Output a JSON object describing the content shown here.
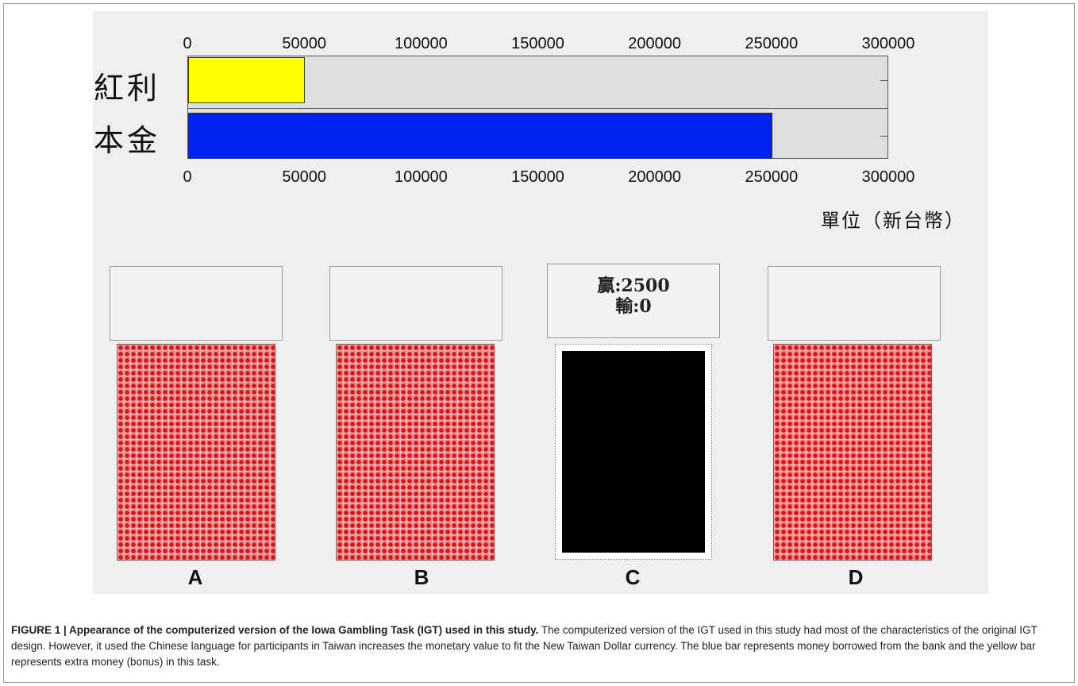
{
  "app": {
    "bar_labels": {
      "bonus": "紅利",
      "principal": "本金"
    },
    "axis": {
      "min": 0,
      "max": 300000,
      "ticks": [
        "0",
        "50000",
        "100000",
        "150000",
        "200000",
        "250000",
        "300000"
      ],
      "unit_label": "單位（新台幣）"
    },
    "bars": {
      "bonus": {
        "value": 50000,
        "color": "#ffff00"
      },
      "principal": {
        "value": 250000,
        "color": "#0022ee"
      }
    },
    "decks": [
      {
        "label": "A",
        "feedback_win": "",
        "feedback_loss": "",
        "selected": false
      },
      {
        "label": "B",
        "feedback_win": "",
        "feedback_loss": "",
        "selected": false
      },
      {
        "label": "C",
        "feedback_win": "贏:2500",
        "feedback_loss": "輸:0",
        "selected": true
      },
      {
        "label": "D",
        "feedback_win": "",
        "feedback_loss": "",
        "selected": false
      }
    ],
    "colors": {
      "background": "#efefef",
      "deck_pattern": "#e02020",
      "selected_card": "#000000"
    }
  },
  "caption": {
    "title": "FIGURE 1 | Appearance of the computerized version of the Iowa Gambling Task (IGT) used in this study.",
    "body": "The computerized version of the IGT used in this study had most of the characteristics of the original IGT design. However, it used the Chinese language for participants in Taiwan increases the monetary value to fit the New Taiwan Dollar currency. The blue bar represents money borrowed from the bank and the yellow bar represents extra money (bonus) in this task."
  }
}
